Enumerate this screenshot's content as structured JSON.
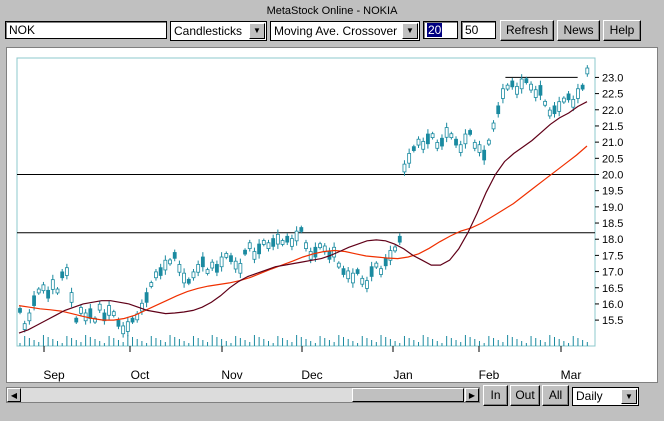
{
  "window": {
    "title": "MetaStock Online - NOKIA"
  },
  "toolbar": {
    "symbol": "NOK",
    "chart_style": "Candlesticks",
    "indicator": "Moving Ave. Crossover",
    "period_short": "20",
    "period_long": "50",
    "refresh_label": "Refresh",
    "news_label": "News",
    "help_label": "Help"
  },
  "bottom": {
    "in_label": "In",
    "out_label": "Out",
    "all_label": "All",
    "interval": "Daily"
  },
  "colors": {
    "price": "#1a8aa0",
    "ma_short": "#600018",
    "ma_long": "#f03000",
    "grid": "#8cc8cc"
  },
  "chart_data": {
    "type": "candlestick",
    "x_labels": [
      "Sep",
      "Oct",
      "Nov",
      "Dec",
      "Jan",
      "Feb",
      "Mar"
    ],
    "y_ticks": [
      15.5,
      16.0,
      16.5,
      17.0,
      17.5,
      18.0,
      18.5,
      19.0,
      19.5,
      20.0,
      20.5,
      21.0,
      21.5,
      22.0,
      22.5,
      23.0
    ],
    "ylim": [
      14.7,
      23.6
    ],
    "horizontal_lines": [
      23.0,
      20.0,
      18.2
    ],
    "price": [
      15.8,
      15.3,
      15.6,
      16.1,
      16.4,
      16.5,
      16.3,
      16.6,
      16.4,
      16.9,
      17.0,
      16.2,
      15.5,
      15.8,
      15.6,
      15.7,
      15.5,
      15.9,
      15.6,
      15.8,
      15.7,
      15.4,
      15.2,
      15.3,
      15.5,
      15.6,
      15.9,
      16.2,
      16.6,
      16.9,
      17.0,
      17.2,
      17.3,
      17.5,
      17.1,
      16.8,
      16.7,
      16.9,
      17.1,
      17.3,
      17.0,
      17.2,
      17.1,
      17.3,
      17.5,
      17.4,
      17.2,
      17.1,
      17.6,
      17.8,
      17.5,
      17.7,
      17.9,
      17.8,
      17.9,
      18.0,
      17.9,
      18.0,
      17.9,
      18.1,
      18.3,
      17.8,
      17.5,
      17.6,
      17.8,
      17.7,
      17.5,
      17.6,
      17.2,
      17.0,
      16.9,
      16.8,
      17.0,
      16.7,
      16.6,
      17.0,
      17.2,
      17.0,
      17.3,
      17.5,
      17.7,
      18.0,
      20.2,
      20.5,
      20.8,
      21.0,
      20.9,
      21.1,
      21.2,
      20.9,
      21.0,
      21.3,
      21.2,
      21.0,
      20.8,
      21.1,
      21.3,
      20.9,
      20.8,
      20.6,
      21.0,
      21.5,
      22.0,
      22.5,
      22.7,
      22.8,
      22.6,
      22.8,
      22.9,
      22.7,
      22.5,
      22.6,
      22.2,
      21.9,
      22.0,
      22.1,
      22.3,
      22.4,
      22.2,
      22.5,
      22.7,
      23.2
    ],
    "ma_short": [
      15.1,
      15.2,
      15.35,
      15.5,
      15.65,
      15.8,
      15.9,
      16.0,
      16.05,
      16.1,
      16.1,
      16.05,
      16.0,
      15.9,
      15.8,
      15.75,
      15.7,
      15.72,
      15.75,
      15.8,
      15.9,
      16.05,
      16.25,
      16.5,
      16.7,
      16.85,
      16.95,
      17.05,
      17.15,
      17.2,
      17.25,
      17.3,
      17.35,
      17.4,
      17.5,
      17.62,
      17.75,
      17.85,
      17.95,
      17.98,
      17.95,
      17.85,
      17.7,
      17.5,
      17.35,
      17.2,
      17.2,
      17.35,
      17.7,
      18.2,
      18.8,
      19.45,
      20.0,
      20.4,
      20.65,
      20.85,
      21.05,
      21.3,
      21.55,
      21.75,
      21.9,
      22.1,
      22.25
    ],
    "ma_long": [
      15.95,
      15.9,
      15.85,
      15.82,
      15.78,
      15.7,
      15.62,
      15.55,
      15.5,
      15.5,
      15.55,
      15.65,
      15.8,
      15.95,
      16.1,
      16.25,
      16.38,
      16.48,
      16.55,
      16.6,
      16.65,
      16.72,
      16.82,
      16.95,
      17.08,
      17.2,
      17.32,
      17.45,
      17.55,
      17.62,
      17.65,
      17.62,
      17.55,
      17.48,
      17.45,
      17.42,
      17.4,
      17.45,
      17.55,
      17.72,
      17.92,
      18.1,
      18.25,
      18.35,
      18.5,
      18.7,
      18.9,
      19.1,
      19.35,
      19.6,
      19.85,
      20.1,
      20.35,
      20.6,
      20.88
    ]
  }
}
